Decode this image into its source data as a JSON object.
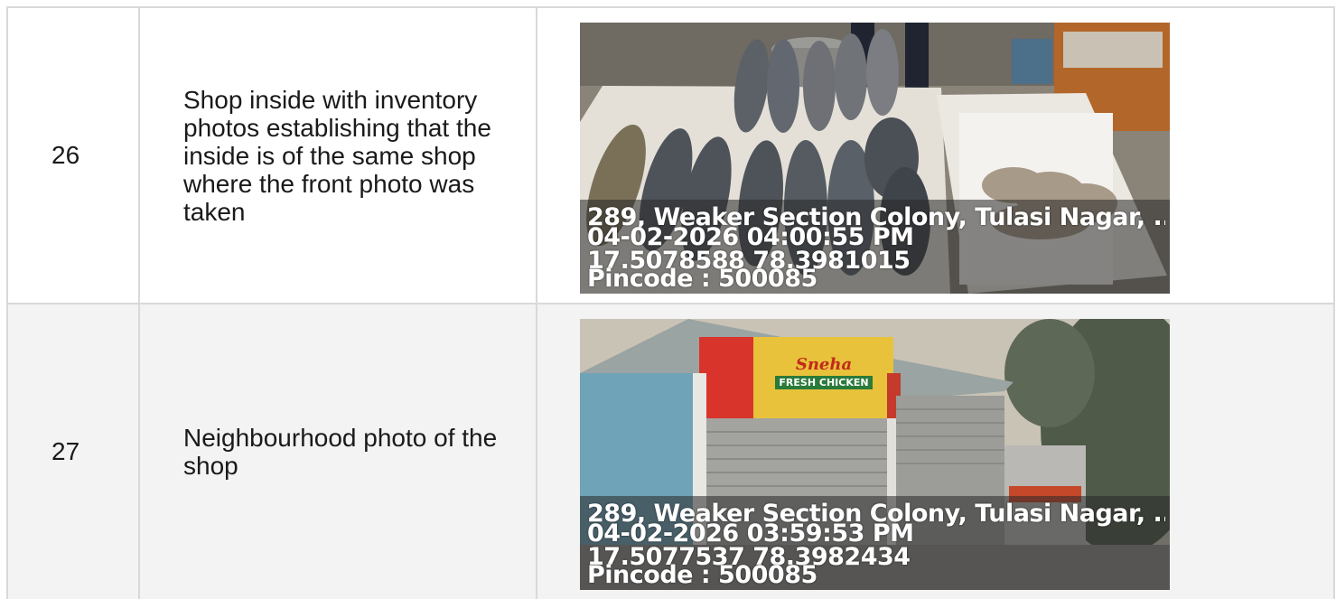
{
  "rows": [
    {
      "number": "26",
      "description": "Shop inside with inventory photos establishing that the inside is of the same shop where the front photo was taken",
      "photo": {
        "subject": "fish-and-prawns-inventory",
        "stamp_address": "289, Weaker Section Colony, Tulasi Nagar, ...",
        "stamp_datetime": "04-02-2026 04:00:55 PM",
        "stamp_coordinates": "17.5078588 78.3981015",
        "stamp_pincode": "Pincode : 500085"
      }
    },
    {
      "number": "27",
      "description": "Neighbourhood photo of the shop",
      "photo": {
        "subject": "shop-front-shutters",
        "sign_brand": "Sneha",
        "sign_title": "FRESH CHICKEN",
        "stamp_address": "289, Weaker Section Colony, Tulasi Nagar, ...",
        "stamp_datetime": "04-02-2026 03:59:53 PM",
        "stamp_coordinates": "17.5077537 78.3982434",
        "stamp_pincode": "Pincode : 500085"
      }
    }
  ],
  "colors": {
    "border": "#d9d9d9",
    "row_alt_background": "#f3f3f3",
    "text": "#1a1a1a",
    "stamp_text": "#ffffff"
  }
}
